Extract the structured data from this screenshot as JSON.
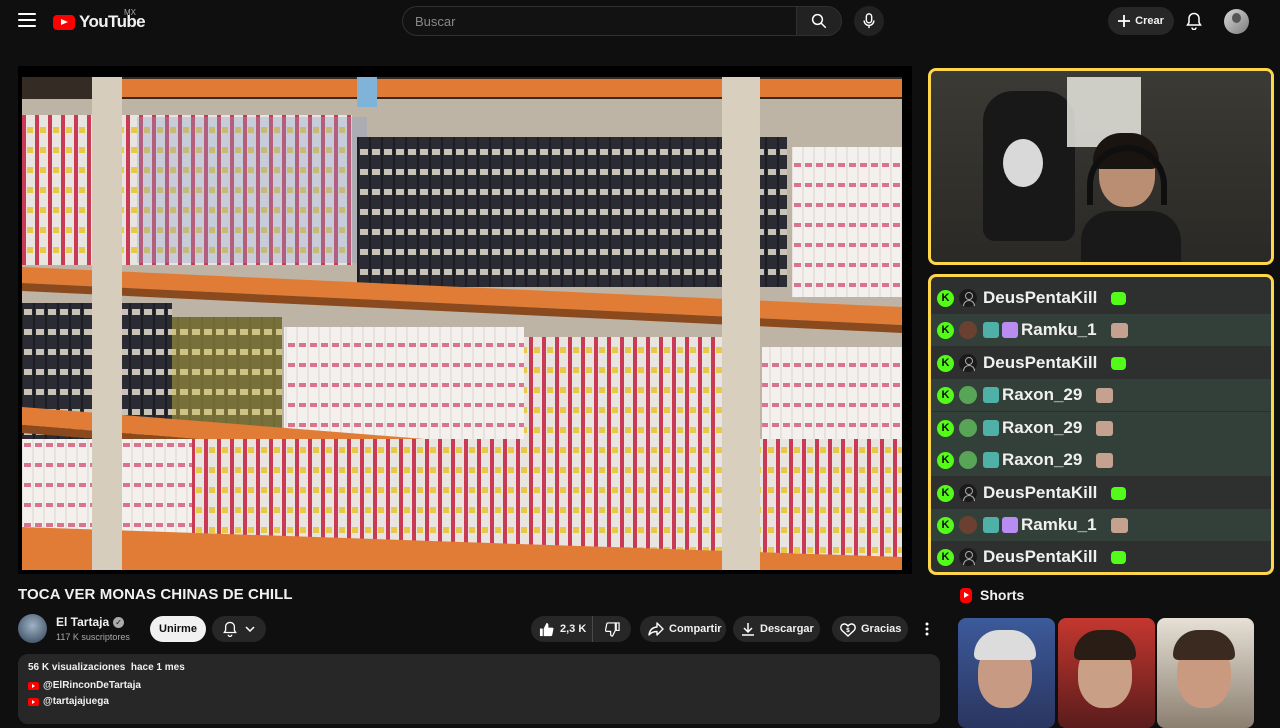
{
  "header": {
    "logo_text": "YouTube",
    "country_code": "MX",
    "search_placeholder": "Buscar",
    "create_label": "Crear"
  },
  "video": {
    "title": "TOCA VER MONAS CHINAS DE CHILL"
  },
  "channel": {
    "name": "El Tartaja",
    "subscribers": "117 K suscriptores",
    "join_label": "Unirme"
  },
  "actions": {
    "likes": "2,3 K",
    "share_label": "Compartir",
    "download_label": "Descargar",
    "thanks_label": "Gracias"
  },
  "description": {
    "views": "56 K visualizaciones",
    "date": "hace 1 mes",
    "links": [
      "@ElRinconDeTartaja",
      "@tartajajuega"
    ]
  },
  "chat": {
    "messages": [
      {
        "user": "DeusPentaKill",
        "badge": "default",
        "emote": "green"
      },
      {
        "user": "Ramku_1",
        "badge": "face",
        "emote": "cat"
      },
      {
        "user": "DeusPentaKill",
        "badge": "default",
        "emote": "green"
      },
      {
        "user": "Raxon_29",
        "badge": "green",
        "emote": "cat"
      },
      {
        "user": "Raxon_29",
        "badge": "green",
        "emote": "cat"
      },
      {
        "user": "Raxon_29",
        "badge": "green",
        "emote": "cat"
      },
      {
        "user": "DeusPentaKill",
        "badge": "default",
        "emote": "green"
      },
      {
        "user": "Ramku_1",
        "badge": "face",
        "emote": "cat"
      },
      {
        "user": "DeusPentaKill",
        "badge": "default",
        "emote": "green"
      }
    ],
    "accent_color": "#53fc18",
    "frame_color": "#ffd54a"
  },
  "shorts": {
    "heading": "Shorts"
  }
}
